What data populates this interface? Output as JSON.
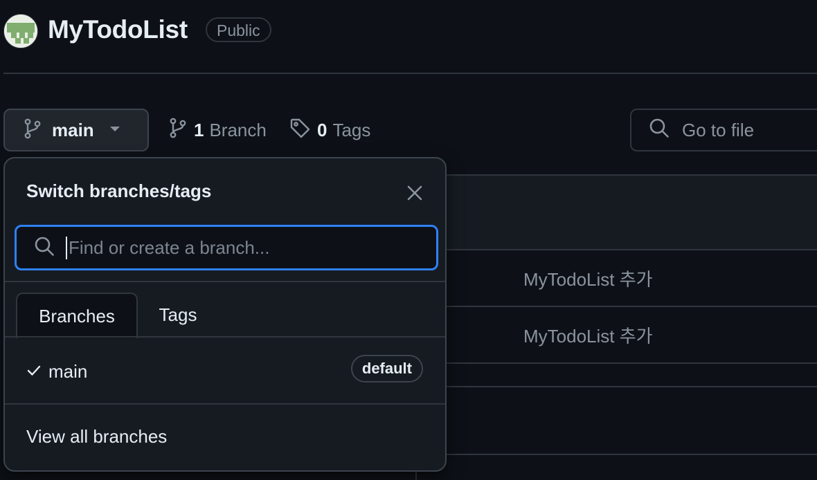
{
  "repo": {
    "name": "MyTodoList",
    "visibility": "Public"
  },
  "toolbar": {
    "current_branch": "main",
    "branch_count": "1",
    "branch_label": "Branch",
    "tag_count": "0",
    "tag_label": "Tags",
    "go_to_file_placeholder": "Go to file"
  },
  "files": {
    "rows": [
      {
        "commit_message": "MyTodoList 추가"
      },
      {
        "commit_message": "MyTodoList 추가"
      }
    ]
  },
  "dropdown": {
    "title": "Switch branches/tags",
    "search_placeholder": "Find or create a branch...",
    "tabs": [
      {
        "label": "Branches",
        "active": true
      },
      {
        "label": "Tags",
        "active": false
      }
    ],
    "branches": [
      {
        "name": "main",
        "badge": "default",
        "selected": true
      }
    ],
    "view_all_label": "View all branches"
  },
  "icons": {
    "branch": "git-branch-icon",
    "tag": "tag-icon",
    "search": "search-icon",
    "close": "close-icon",
    "check": "check-icon",
    "caret": "triangle-down-icon"
  },
  "colors": {
    "background": "#0d1117",
    "panel": "#161b22",
    "border": "#30363d",
    "focus": "#2f81f7",
    "text": "#e6edf3",
    "muted": "#8b949e"
  }
}
